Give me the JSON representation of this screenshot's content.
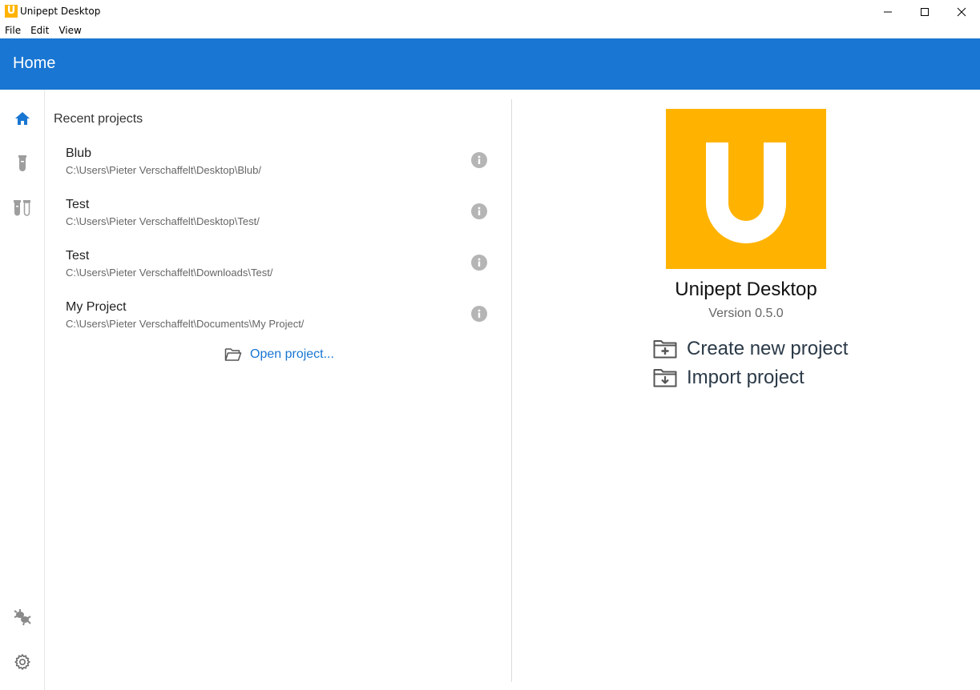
{
  "window": {
    "icon_letter": "U",
    "title": "Unipept Desktop"
  },
  "menu": [
    "File",
    "Edit",
    "View"
  ],
  "header": {
    "title": "Home"
  },
  "sidebar": {
    "items": [
      {
        "icon": "home-icon",
        "active": true
      },
      {
        "icon": "test-tube-icon",
        "active": false
      },
      {
        "icon": "test-tubes-compare-icon",
        "active": false
      }
    ],
    "bottom_items": [
      {
        "icon": "bacteria-icon"
      },
      {
        "icon": "settings-gear-icon"
      }
    ]
  },
  "recent": {
    "title": "Recent projects",
    "projects": [
      {
        "name": "Blub",
        "path": "C:\\Users\\Pieter Verschaffelt\\Desktop\\Blub/"
      },
      {
        "name": "Test",
        "path": "C:\\Users\\Pieter Verschaffelt\\Desktop\\Test/"
      },
      {
        "name": "Test",
        "path": "C:\\Users\\Pieter Verschaffelt\\Downloads\\Test/"
      },
      {
        "name": "My Project",
        "path": "C:\\Users\\Pieter Verschaffelt\\Documents\\My Project/"
      }
    ],
    "open_label": "Open project..."
  },
  "about": {
    "logo_letter": "U",
    "app_name": "Unipept Desktop",
    "version": "Version 0.5.0",
    "create_label": "Create new project",
    "import_label": "Import project"
  },
  "colors": {
    "primary": "#1976D2",
    "logo": "#FFB300",
    "icon_gray": "#9e9e9e"
  }
}
